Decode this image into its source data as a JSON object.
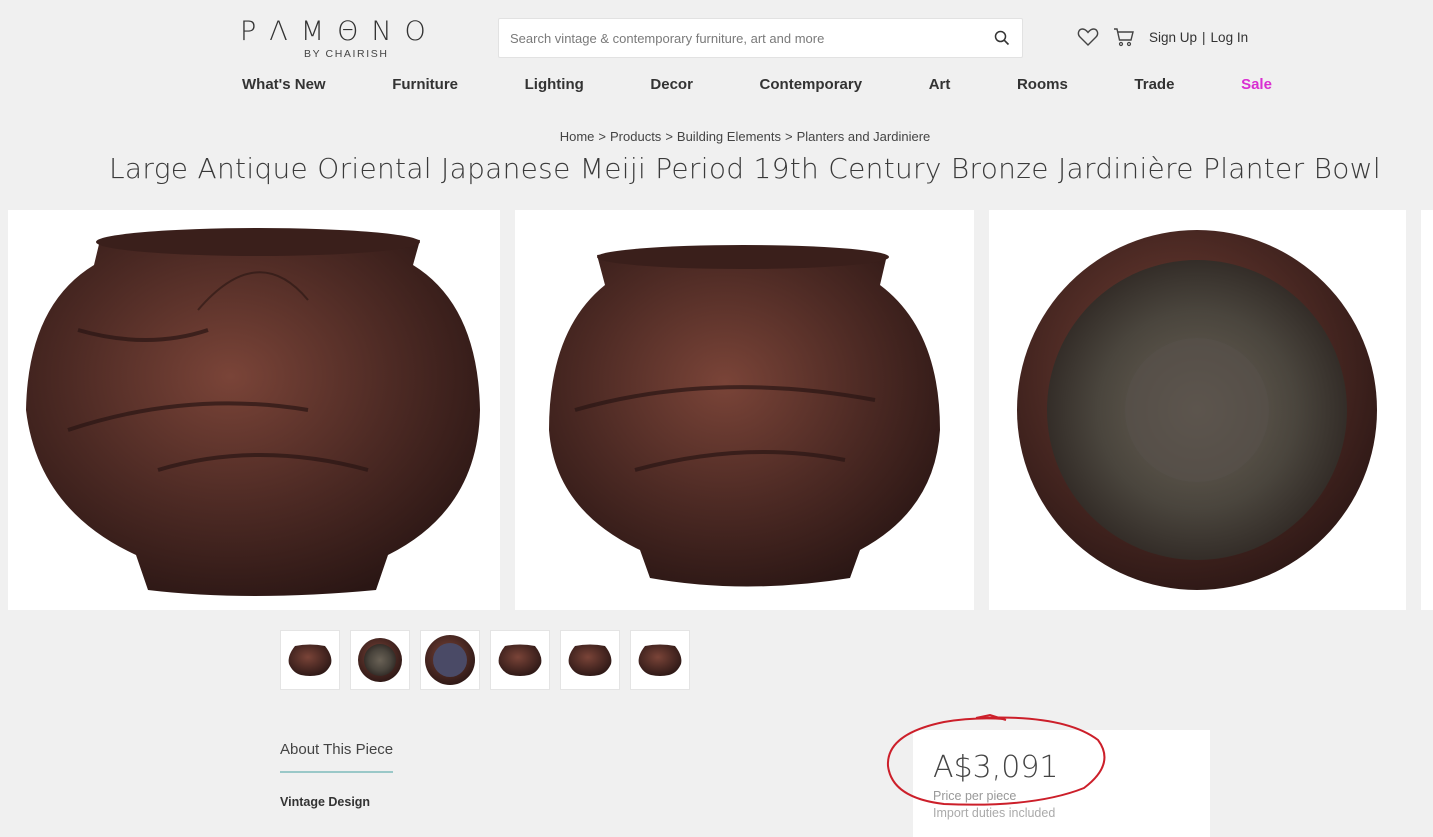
{
  "brand": {
    "letters": [
      "P",
      "Λ",
      "M",
      "Θ",
      "N",
      "O"
    ],
    "sub": "BY CHAIRISH"
  },
  "search": {
    "placeholder": "Search vintage & contemporary furniture, art and more"
  },
  "header": {
    "signup": "Sign Up",
    "divider": "|",
    "login": "Log In"
  },
  "nav": [
    "What's New",
    "Furniture",
    "Lighting",
    "Decor",
    "Contemporary",
    "Art",
    "Rooms",
    "Trade",
    "Sale"
  ],
  "breadcrumb": [
    "Home",
    "Products",
    "Building Elements",
    "Planters and Jardiniere"
  ],
  "breadcrumb_sep": ">",
  "product": {
    "title": "Large Antique Oriental Japanese Meiji Period 19th Century Bronze Jardinière Planter Bowl",
    "about_tab": "About This Piece",
    "design": "Vintage Design",
    "price": "A$3,091",
    "price_note": "Price per piece",
    "duties": "Import duties included"
  },
  "colors": {
    "accent_sale": "#d92ed1",
    "tab_underline": "#9ac8c8",
    "annotation": "#cc1f2a",
    "bronze": "#4a2a25"
  }
}
